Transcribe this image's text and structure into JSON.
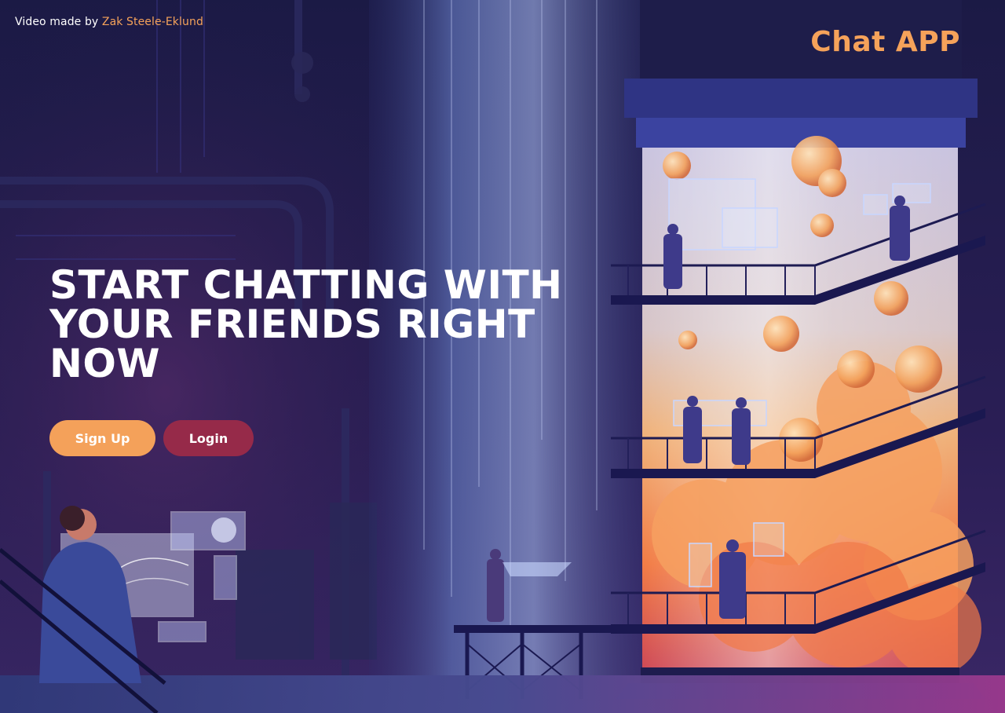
{
  "credit": {
    "prefix": "Video made by ",
    "author": "Zak Steele-Eklund"
  },
  "brand": {
    "title": "Chat APP"
  },
  "hero": {
    "heading": "START CHATTING WITH YOUR FRIENDS RIGHT NOW"
  },
  "actions": {
    "signup_label": "Sign Up",
    "login_label": "Login"
  },
  "colors": {
    "accent": "#f5a25a",
    "login_button": "#962a49",
    "background": "#1c1a44"
  },
  "background_illustration": "industrial-lab-scientists-tank"
}
